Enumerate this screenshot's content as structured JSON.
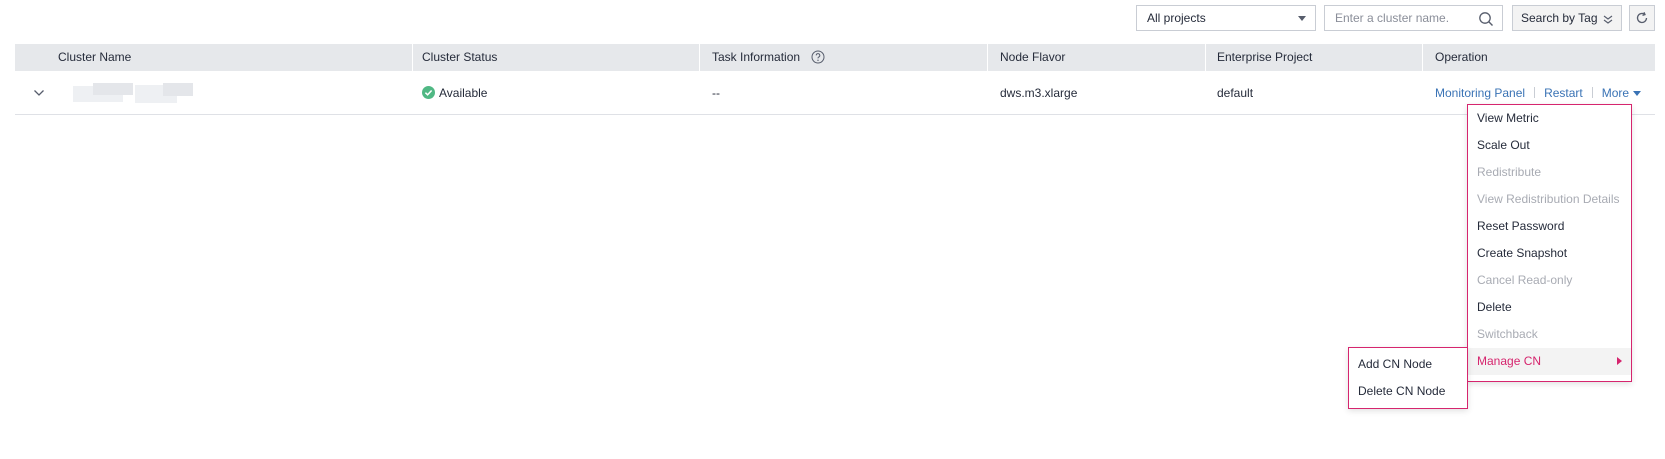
{
  "toolbar": {
    "project_select": "All projects",
    "search_placeholder": "Enter a cluster name.",
    "tag_search_label": "Search by Tag"
  },
  "table": {
    "columns": [
      "Cluster Name",
      "Cluster Status",
      "Task Information",
      "Node Flavor",
      "Enterprise Project",
      "Operation"
    ],
    "rows": [
      {
        "status": "Available",
        "task_info": "--",
        "node_flavor": "dws.m3.xlarge",
        "enterprise_project": "default",
        "operations": [
          "Monitoring Panel",
          "Restart",
          "More"
        ]
      }
    ]
  },
  "more_menu": {
    "items": [
      {
        "label": "View Metric",
        "enabled": true
      },
      {
        "label": "Scale Out",
        "enabled": true
      },
      {
        "label": "Redistribute",
        "enabled": false
      },
      {
        "label": "View Redistribution Details",
        "enabled": false
      },
      {
        "label": "Reset Password",
        "enabled": true
      },
      {
        "label": "Create Snapshot",
        "enabled": true
      },
      {
        "label": "Cancel Read-only",
        "enabled": false
      },
      {
        "label": "Delete",
        "enabled": true
      },
      {
        "label": "Switchback",
        "enabled": false
      },
      {
        "label": "Manage CN",
        "enabled": true,
        "active": true
      }
    ]
  },
  "manage_cn_submenu": {
    "items": [
      "Add CN Node",
      "Delete CN Node"
    ]
  },
  "colors": {
    "accent": "#d6256e",
    "link": "#3a73b5",
    "status_ok": "#50b884",
    "header_bg": "#e6e8eb"
  }
}
